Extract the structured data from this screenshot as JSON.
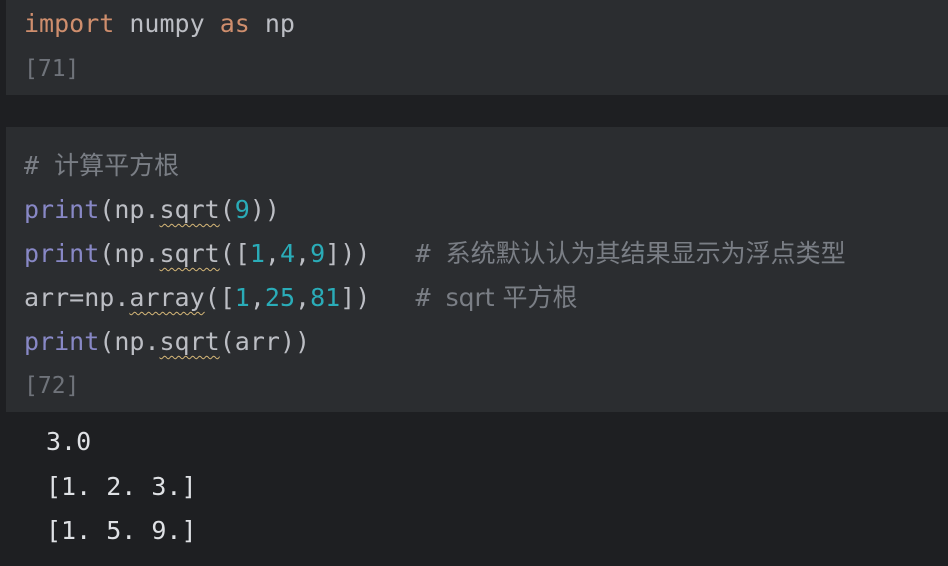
{
  "cell1": {
    "keyword_import": "import",
    "module": "numpy",
    "keyword_as": "as",
    "alias": "np",
    "prompt": "[71]"
  },
  "cell2": {
    "comment_hash": "#",
    "comment_text": "计算平方根",
    "print_fn": "print",
    "np_ref": "np",
    "sqrt_fn": "sqrt",
    "array_fn": "array",
    "arg_9": "9",
    "list1": [
      "1",
      "4",
      "9"
    ],
    "inline_comment1_text": "系统默认认为其结果显示为浮点类型",
    "arr_var": "arr",
    "list2": [
      "1",
      "25",
      "81"
    ],
    "inline_comment2_text": "sqrt 平方根",
    "prompt": "[72]"
  },
  "output": {
    "lines": [
      "3.0",
      "[1. 2. 3.]",
      "[1. 5. 9.]"
    ]
  }
}
